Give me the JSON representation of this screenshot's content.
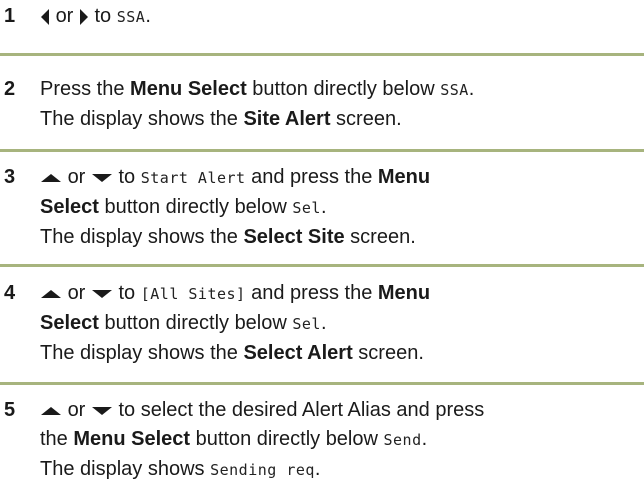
{
  "steps": [
    {
      "number": "1",
      "or": "or",
      "to": "to",
      "lcd_ssa": "SSA",
      "period": "."
    },
    {
      "number": "2",
      "l1_a": "Press the ",
      "menu_select": "Menu Select",
      "l1_b": " button directly below ",
      "lcd_ssa": "SSA",
      "l1_c": ".",
      "l2_a": "The display shows the ",
      "site_alert": "Site Alert",
      "l2_b": " screen."
    },
    {
      "number": "3",
      "or": "or",
      "to": "to",
      "lcd_start_alert": "Start Alert",
      "l1_b": " and press the ",
      "menu": "Menu",
      "select": "Select",
      "l2_b": " button directly below ",
      "lcd_sel": "Sel",
      "l2_c": ".",
      "l3_a": "The display shows the ",
      "select_site": "Select Site",
      "l3_b": " screen."
    },
    {
      "number": "4",
      "or": "or",
      "to": "to",
      "lcd_all_sites": "[All Sites]",
      "l1_b": " and press the ",
      "menu": "Menu",
      "select": "Select",
      "l2_b": " button directly below ",
      "lcd_sel": "Sel",
      "l2_c": ".",
      "l3_a": "The display shows the ",
      "select_alert": "Select Alert",
      "l3_b": " screen."
    },
    {
      "number": "5",
      "or": "or",
      "l1_b": "to select the desired Alert Alias and press",
      "l2_a": "the ",
      "menu_select": "Menu Select",
      "l2_b": " button directly below ",
      "lcd_send": "Send",
      "l2_c": ".",
      "l3_a": "The display shows ",
      "lcd_sending": "Sending req",
      "l3_b": "."
    }
  ],
  "icons": {
    "left": "left-arrow-icon",
    "right": "right-arrow-icon",
    "up": "up-arrow-icon",
    "down": "down-arrow-icon"
  },
  "colors": {
    "divider": "#a7b47e",
    "text": "#1a1a1a"
  }
}
